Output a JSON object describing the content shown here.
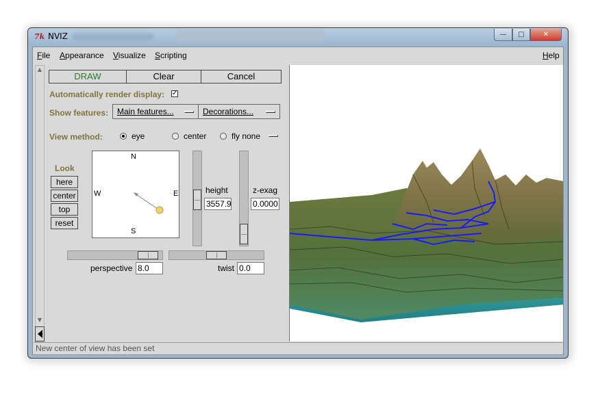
{
  "window": {
    "title": "NVIZ",
    "min_glyph": "—",
    "max_glyph": "□",
    "close_glyph": "✕"
  },
  "menubar": {
    "file": {
      "u": "F",
      "rest": "ile"
    },
    "appearance": {
      "u": "A",
      "rest": "ppearance"
    },
    "visualize": {
      "u": "V",
      "rest": "isualize"
    },
    "scripting": {
      "u": "S",
      "rest": "cripting"
    },
    "help": {
      "u": "H",
      "rest": "elp"
    }
  },
  "buttons": {
    "draw": "DRAW",
    "clear": "Clear",
    "cancel": "Cancel"
  },
  "auto_render": {
    "label": "Automatically render display:",
    "checked": true,
    "mark": "✓"
  },
  "show_features": {
    "label": "Show features:",
    "main": "Main features...",
    "decorations": "Decorations..."
  },
  "view_method": {
    "label": "View method:",
    "options": [
      "eye",
      "center",
      "fly none"
    ],
    "selected": "eye"
  },
  "look": {
    "label": "Look",
    "here": "here",
    "center": "center",
    "top": "top",
    "reset": "reset"
  },
  "compass": {
    "n": "N",
    "s": "S",
    "e": "E",
    "w": "W"
  },
  "height": {
    "label": "height",
    "value": "3557.9"
  },
  "zexag": {
    "label": "z-exag",
    "value": "0.0000"
  },
  "perspective": {
    "label": "perspective",
    "value": "8.0"
  },
  "twist": {
    "label": "twist",
    "value": "0.0"
  },
  "status": "New center of view has been set",
  "colors": {
    "olive_label": "#7f7440",
    "draw_green": "#2b7a2b",
    "vector_blue": "#1a1aff",
    "base_teal": "#2b9a9a"
  }
}
